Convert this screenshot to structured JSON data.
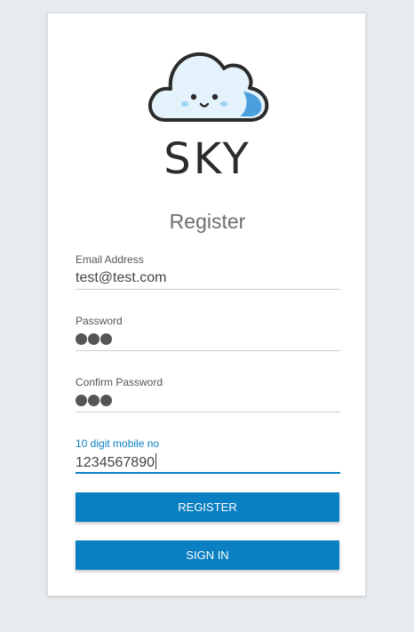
{
  "brand": {
    "name": "SKY",
    "logo_icon": "smiling-cloud-icon",
    "colors": {
      "outline": "#2b2b2b",
      "fill": "#e3f2fb",
      "accent": "#4a9fdd"
    }
  },
  "form": {
    "title": "Register",
    "fields": [
      {
        "label": "Email Address",
        "value": "test@test.com",
        "type": "email"
      },
      {
        "label": "Password",
        "value": "●●●",
        "type": "password"
      },
      {
        "label": "Confirm Password",
        "value": "●●●",
        "type": "password"
      },
      {
        "label": "10 digit mobile no",
        "value": "1234567890",
        "type": "tel",
        "focused": true
      }
    ],
    "register_label": "REGISTER",
    "signin_label": "SIGN IN"
  },
  "colors": {
    "primary": "#0a7fc1",
    "background": "#e8ebee",
    "card": "#ffffff"
  }
}
